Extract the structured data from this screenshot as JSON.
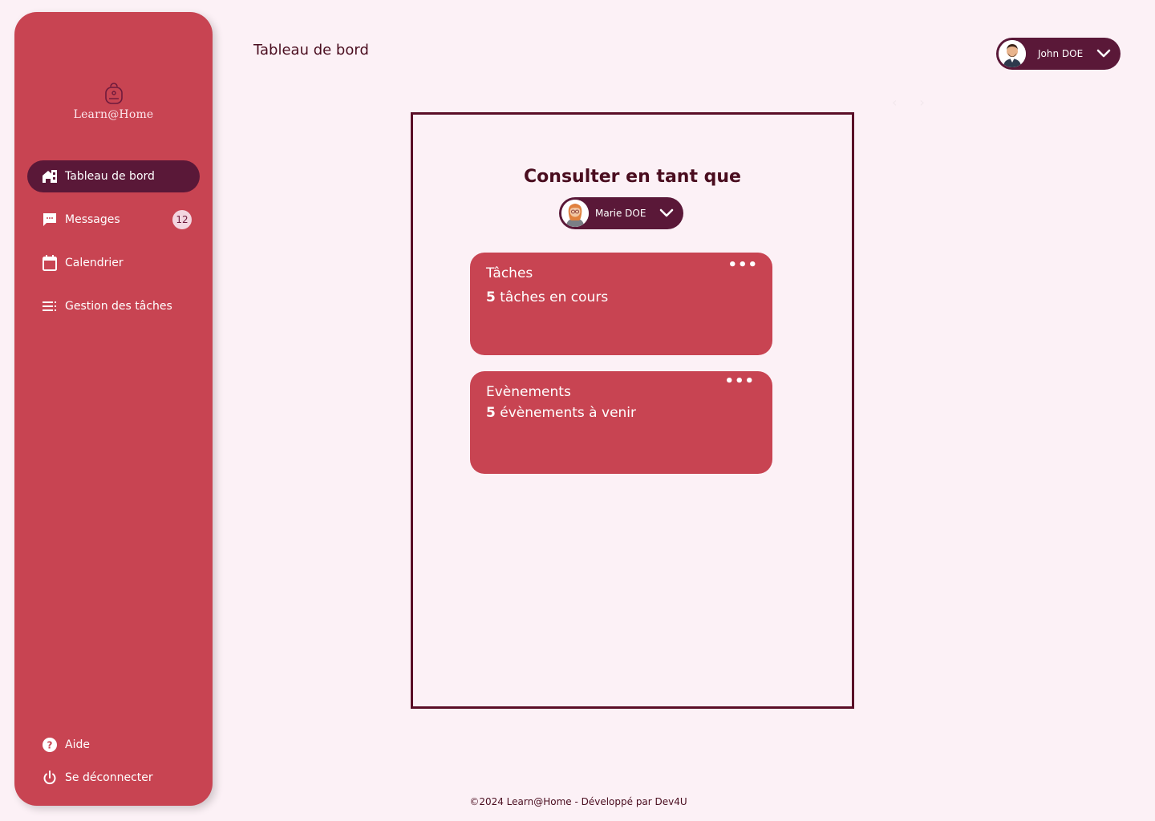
{
  "brand": {
    "name": "Learn@Home"
  },
  "header": {
    "title": "Tableau de bord"
  },
  "user": {
    "name": "John DOE"
  },
  "sidebar": {
    "items": [
      {
        "label": "Tableau de bord",
        "icon": "dashboard-icon",
        "active": true
      },
      {
        "label": "Messages",
        "icon": "message-icon",
        "badge": "12"
      },
      {
        "label": "Calendrier",
        "icon": "calendar-icon"
      },
      {
        "label": "Gestion des tâches",
        "icon": "task-list-icon"
      }
    ],
    "bottom": [
      {
        "label": "Aide",
        "icon": "help-icon"
      },
      {
        "label": "Se déconnecter",
        "icon": "power-icon"
      }
    ]
  },
  "main": {
    "consult_title": "Consulter en tant que",
    "selected_child": "Marie DOE",
    "cards": [
      {
        "title": "Tâches",
        "count": "5",
        "text": "tâches en cours"
      },
      {
        "title": "Evènements",
        "count": "5",
        "text": "évènements à venir"
      }
    ]
  },
  "footer": {
    "text": "©2024 Learn@Home - Développé par Dev4U"
  },
  "colors": {
    "background": "#fcf1f6",
    "sidebar": "#c84452",
    "accent_dark": "#5a1838",
    "text_dark": "#4a0d1f"
  }
}
